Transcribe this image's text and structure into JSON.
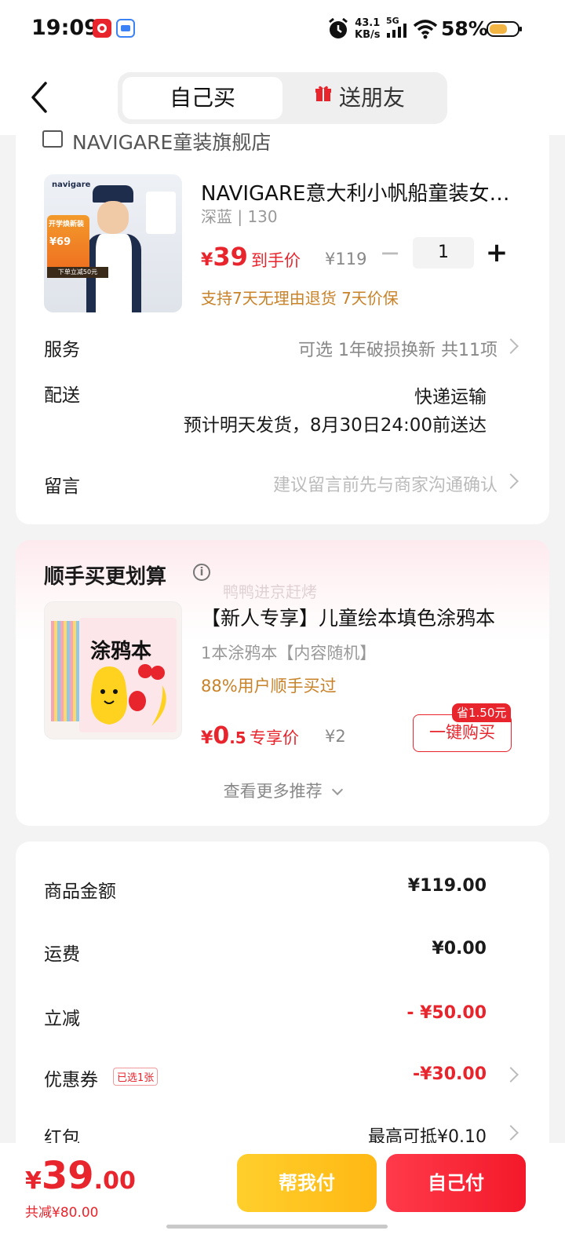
{
  "status_bar": {
    "time": "19:09",
    "net_speed_value": "43.1",
    "net_speed_unit": "KB/s",
    "network": "5G",
    "battery": "58%"
  },
  "header": {
    "tab_active": "自己买",
    "tab_other": "送朋友"
  },
  "order": {
    "store_name": "NAVIGARE童装旗舰店",
    "product": {
      "title": "NAVIGARE意大利小帆船童装女…",
      "spec": "深蓝 | 130",
      "price_currency": "¥",
      "price": "39",
      "price_tag": "到手价",
      "original_price": "¥119",
      "quantity": "1",
      "promise": "支持7天无理由退货  7天价保",
      "image_brand": "navigare",
      "image_banner": "开学焕新装",
      "image_price": "¥69",
      "image_promo": "下单立减50元"
    },
    "service": {
      "label": "服务",
      "value": "可选 1年破损换新 共11项"
    },
    "delivery": {
      "label": "配送",
      "method": "快递运输",
      "eta": "预计明天发货，8月30日24:00前送达"
    },
    "message": {
      "label": "留言",
      "placeholder": "建议留言前先与商家沟通确认"
    }
  },
  "recommend": {
    "title": "顺手买更划算",
    "watermark": "鸭鸭进京赶烤",
    "item": {
      "name": "【新人专享】儿童绘本填色涂鸦本",
      "sub": "1本涂鸦本【内容随机】",
      "stat": "88%用户顺手买过",
      "price_currency": "¥",
      "price_int": "0",
      "price_dec": ".5",
      "price_tag": "专享价",
      "original_price": "¥2",
      "save_badge": "省1.50元",
      "buy_label": "一键购买",
      "image_text": "涂鸦本"
    },
    "see_more": "查看更多推荐"
  },
  "fees": [
    {
      "label": "商品金额",
      "value": "¥119.00",
      "red": false
    },
    {
      "label": "运费",
      "value": "¥0.00",
      "red": false
    },
    {
      "label": "立减",
      "value": "- ¥50.00",
      "red": true
    },
    {
      "label": "优惠券",
      "value": "-¥30.00",
      "red": true,
      "tag": "已选1张"
    },
    {
      "label": "红包",
      "value": "最高可抵¥0.10",
      "red": false
    }
  ],
  "bottom": {
    "currency": "¥",
    "total_int": "39",
    "total_dec": ".00",
    "total_saved": "共减¥80.00",
    "helper_button": "帮我付",
    "pay_button": "自己付"
  },
  "colors": {
    "accent_red": "#e8242c",
    "promise_orange": "#c88228",
    "helper_yellow": "#ffbf1f"
  }
}
